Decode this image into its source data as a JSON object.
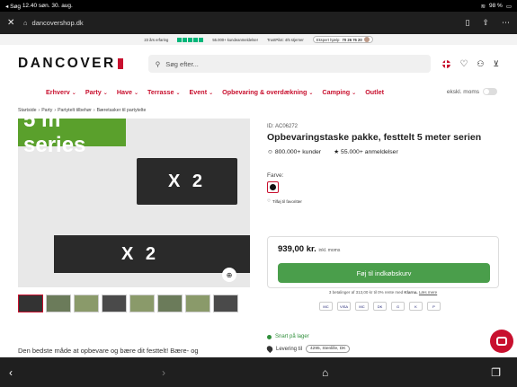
{
  "statusbar": {
    "carrier": "◂ Søg",
    "time": "12.40",
    "date": "søn. 30. aug.",
    "battery": "98 %"
  },
  "browser": {
    "url": "dancovershop.dk",
    "close": "✕",
    "lock": "🔒"
  },
  "trust": {
    "years": "23 års erfaring",
    "customers": "55.000+ kundeanmeldelser",
    "trustpilot": "TrustPilot: 4/5 stjerner",
    "expert_label": "Ekspert hjælp:",
    "phone": "70 26 76 20"
  },
  "header": {
    "logo": "DANCOVER",
    "search_placeholder": "Søg efter..."
  },
  "nav": {
    "items": [
      "Erhverv",
      "Party",
      "Have",
      "Terrasse",
      "Event",
      "Opbevaring & overdækning",
      "Camping",
      "Outlet"
    ],
    "vat_label": "ekskl. moms"
  },
  "breadcrumb": [
    "Startside",
    "Party",
    "Partytelt tilbehør",
    "Bæretasker til partytelte"
  ],
  "gallery": {
    "series": "5 m series",
    "bag1": "X 2",
    "bag2": "X 2"
  },
  "product": {
    "sku": "ID: AC06272",
    "title": "Opbevaringstaske pakke, festtelt 5 meter serien",
    "customers": "800.000+ kunder",
    "reviews": "55.000+ anmeldelser",
    "color_label": "Farve:",
    "fav_label": "Tilføj til favoritter"
  },
  "price": {
    "amount": "939,00 kr.",
    "vat": "inkl. moms",
    "cart_label": "Føj til indkøbskurv"
  },
  "klarna": {
    "text": "3 betalinger af 313,00 kr til 0% rente med",
    "brand": "Klarna.",
    "link": "Læs mere"
  },
  "payments": [
    "MC",
    "VISA",
    "MC",
    "DK",
    "G",
    "K",
    "P"
  ],
  "stock": {
    "text": "Snart på lager"
  },
  "delivery": {
    "label": "Levering til",
    "location": "4295, Stenlille, DK"
  },
  "description": "Den bedste måde at opbevare og bære dit festtelt! Bære- og",
  "colors": {
    "brand": "#c8102e",
    "green": "#4a9e4b"
  }
}
